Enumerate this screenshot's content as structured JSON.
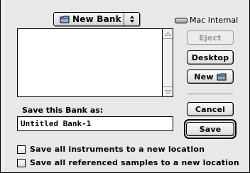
{
  "folder_popup": {
    "label": "New Bank",
    "icon": "folder-icon"
  },
  "volume": {
    "label": "Mac Internal",
    "icon": "disk-icon"
  },
  "file_list": {
    "items": []
  },
  "buttons": {
    "eject": "Eject",
    "desktop": "Desktop",
    "new": "New",
    "cancel": "Cancel",
    "save": "Save"
  },
  "save_as": {
    "label": "Save this Bank as:",
    "value": "Untitled Bank-1"
  },
  "options": [
    {
      "label": "Save all instruments to a new location",
      "checked": false
    },
    {
      "label": "Save all referenced samples to a new location",
      "checked": false
    }
  ],
  "colors": {
    "dialog_bg": "#e8e8e8",
    "disabled_text": "#9a9a9a"
  }
}
